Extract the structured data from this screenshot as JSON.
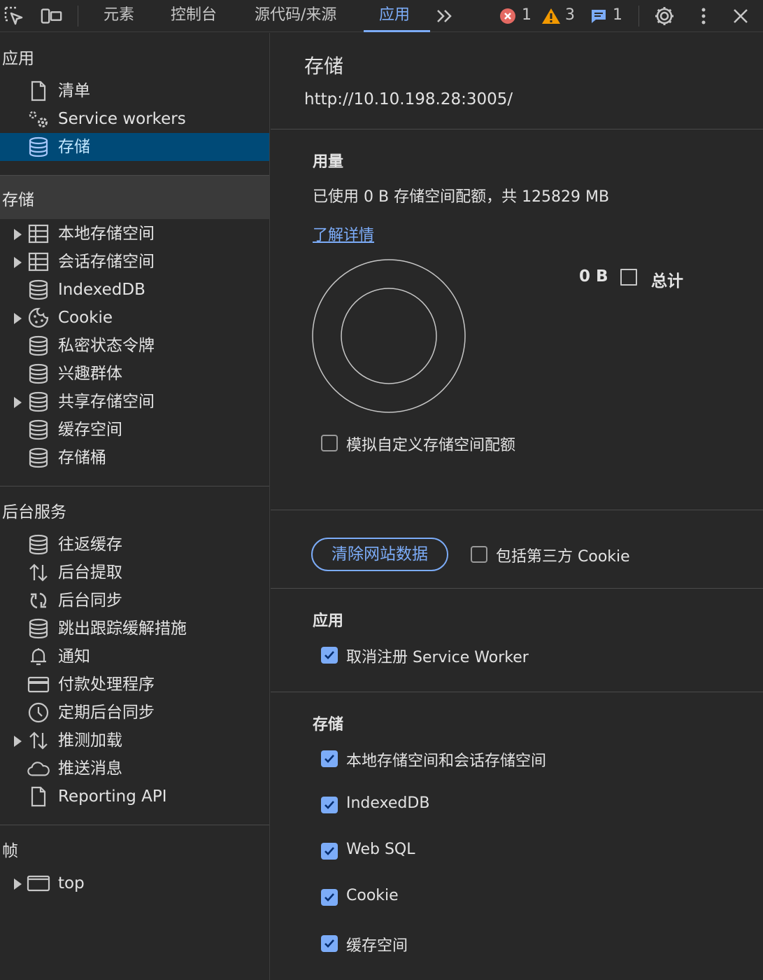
{
  "toolbar": {
    "tabs": [
      "元素",
      "控制台",
      "源代码/来源",
      "应用"
    ],
    "more_tabs": "»",
    "errors": "1",
    "warnings": "3",
    "messages": "1"
  },
  "sidebar": {
    "app_section": "应用",
    "app_items": [
      "清单",
      "Service workers",
      "存储"
    ],
    "storage_section": "存储",
    "storage_items": [
      "本地存储空间",
      "会话存储空间",
      "IndexedDB",
      "Cookie",
      "私密状态令牌",
      "兴趣群体",
      "共享存储空间",
      "缓存空间",
      "存储桶"
    ],
    "bg_section": "后台服务",
    "bg_items": [
      "往返缓存",
      "后台提取",
      "后台同步",
      "跳出跟踪缓解措施",
      "通知",
      "付款处理程序",
      "定期后台同步",
      "推测加载",
      "推送消息",
      "Reporting API"
    ],
    "frames_section": "帧",
    "frames_items": [
      "top"
    ]
  },
  "main": {
    "title": "存储",
    "origin": "http://10.10.198.28:3005/",
    "usage_heading": "用量",
    "usage_text": "已使用 0 B 存储空间配额，共 125829 MB",
    "learn_more": "了解详情",
    "legend_value": "0 B",
    "legend_label": "总计",
    "simulate_quota": "模拟自定义存储空间配额",
    "clear_button": "清除网站数据",
    "third_party_cookie": "包括第三方 Cookie",
    "app_heading": "应用",
    "unregister_sw": "取消注册 Service Worker",
    "storage_heading": "存储",
    "storage_options": [
      "本地存储空间和会话存储空间",
      "IndexedDB",
      "Web SQL",
      "Cookie",
      "缓存空间"
    ]
  },
  "colors": {
    "accent": "#7cacf8",
    "selected_bg": "#004a77",
    "error": "#e46962",
    "warning": "#f29900",
    "info": "#7cacf8"
  }
}
